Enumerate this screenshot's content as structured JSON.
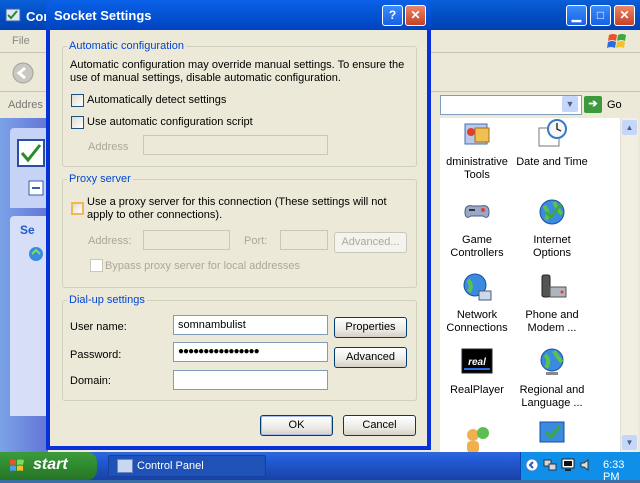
{
  "background_window": {
    "title": "Cont",
    "menu": "File",
    "address_label": "Addres",
    "go_label": "Go",
    "left_pane_heading": "Se",
    "items": [
      {
        "label": "dministrative\nTools",
        "icon": "administrative-tools-icon"
      },
      {
        "label": "Date and Time",
        "icon": "date-time-icon"
      },
      {
        "label": "Game\nControllers",
        "icon": "game-controllers-icon"
      },
      {
        "label": "Internet\nOptions",
        "icon": "internet-options-icon"
      },
      {
        "label": "Network\nConnections",
        "icon": "network-connections-icon"
      },
      {
        "label": "Phone and\nModem ...",
        "icon": "phone-modem-icon"
      },
      {
        "label": "RealPlayer",
        "icon": "realplayer-icon"
      },
      {
        "label": "Regional and\nLanguage ...",
        "icon": "regional-language-icon"
      },
      {
        "label": "",
        "icon": "user-accounts-icon"
      },
      {
        "label": "",
        "icon": "security-center-icon"
      }
    ]
  },
  "dialog": {
    "title": "Socket Settings",
    "help_glyph": "?",
    "close_glyph": "✕",
    "auto_config": {
      "legend": "Automatic configuration",
      "description_line1": "Automatic configuration may override manual settings.  To ensure the",
      "description_line2": "use of manual settings, disable automatic configuration.",
      "detect_label": "Automatically detect settings",
      "detect_checked": false,
      "script_label": "Use automatic configuration script",
      "script_checked": false,
      "address_label": "Address",
      "address_value": ""
    },
    "proxy": {
      "legend": "Proxy server",
      "use_proxy_label_line1": "Use a proxy server for this connection (These settings will not",
      "use_proxy_label_line2": "apply to other connections).",
      "use_proxy_checked": false,
      "address_label": "Address:",
      "address_value": "",
      "port_label": "Port:",
      "port_value": "",
      "advanced_label": "Advanced...",
      "bypass_label": "Bypass proxy server for local addresses",
      "bypass_checked": false
    },
    "dialup": {
      "legend": "Dial-up settings",
      "username_label": "User name:",
      "username_value": "somnambulist",
      "password_label": "Password:",
      "password_value": "●●●●●●●●●●●●●●●●",
      "domain_label": "Domain:",
      "domain_value": "",
      "properties_label": "Properties",
      "advanced_label": "Advanced"
    },
    "ok_label": "OK",
    "cancel_label": "Cancel"
  },
  "taskbar": {
    "start_label": "start",
    "task_label": "Control Panel",
    "clock": "6:33 PM"
  },
  "colors": {
    "title_blue": "#0054e3",
    "dialog_face": "#ece9d8",
    "group_legend": "#0046d5",
    "start_green": "#3c9a3c"
  }
}
